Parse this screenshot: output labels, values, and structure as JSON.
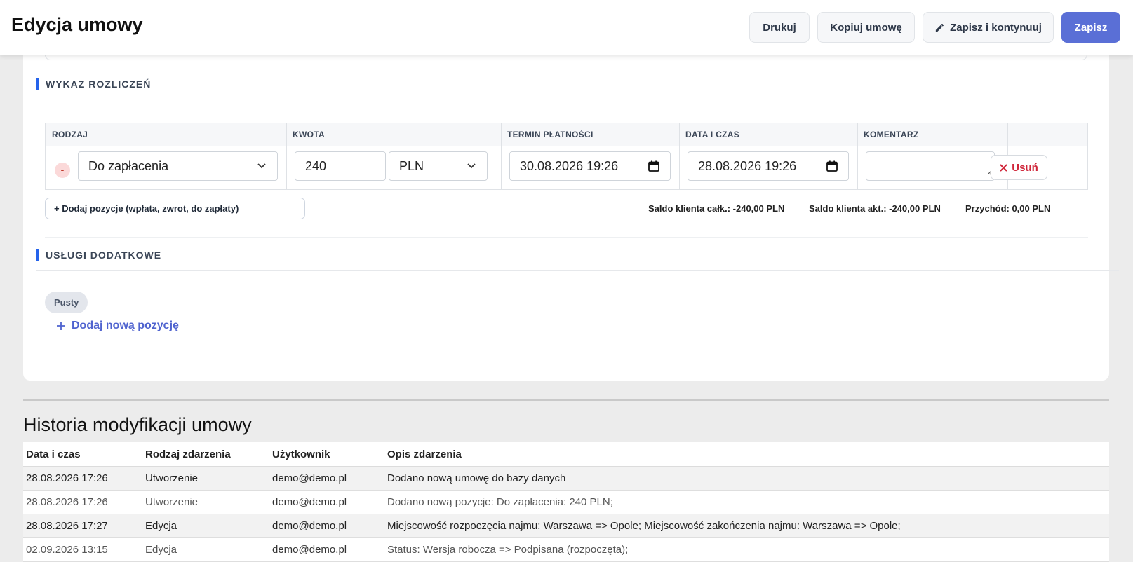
{
  "header": {
    "title": "Edycja umowy",
    "buttons": {
      "print": "Drukuj",
      "copy": "Kopiuj umowę",
      "save_continue": "Zapisz i kontynuuj",
      "save": "Zapisz"
    }
  },
  "settlements": {
    "heading": "WYKAZ ROZLICZEŃ",
    "columns": [
      "RODZAJ",
      "KWOTA",
      "TERMIN PŁATNOŚCI",
      "DATA I CZAS",
      "KOMENTARZ"
    ],
    "row": {
      "remove_marker": "-",
      "type": "Do zapłacenia",
      "amount": "240",
      "currency": "PLN",
      "due_date": "30.08.2026 19:26",
      "datetime": "28.08.2026 19:26",
      "comment": "",
      "delete_label": "Usuń"
    },
    "add_button": "+ Dodaj pozycje (wpłata, zwrot, do zapłaty)",
    "summary": {
      "balance_total": "Saldo klienta całk.: -240,00 PLN",
      "balance_current": "Saldo klienta akt.: -240,00 PLN",
      "income": "Przychód: 0,00 PLN"
    }
  },
  "extra_services": {
    "heading": "USŁUGI DODATKOWE",
    "empty_label": "Pusty",
    "add_label": "Dodaj nową pozycję"
  },
  "history": {
    "title": "Historia modyfikacji umowy",
    "columns": [
      "Data i czas",
      "Rodzaj zdarzenia",
      "Użytkownik",
      "Opis zdarzenia"
    ],
    "rows": [
      [
        "28.08.2026 17:26",
        "Utworzenie",
        "demo@demo.pl",
        "Dodano nową umowę do bazy danych"
      ],
      [
        "28.08.2026 17:26",
        "Utworzenie",
        "demo@demo.pl",
        "Dodano nową pozycje: Do zapłacenia: 240 PLN;"
      ],
      [
        "28.08.2026 17:27",
        "Edycja",
        "demo@demo.pl",
        "Miejscowość rozpoczęcia najmu: Warszawa => Opole; Miejscowość zakończenia najmu: Warszawa => Opole;"
      ],
      [
        "02.09.2026 13:15",
        "Edycja",
        "demo@demo.pl",
        "Status: Wersja robocza => Podpisana (rozpoczęta);"
      ]
    ]
  },
  "colors": {
    "primary": "#5a6fd6",
    "section_accent": "#2563eb",
    "danger": "#d0263a",
    "link": "#4f63cf"
  },
  "icons": [
    "pencil-icon",
    "chevron-down-icon",
    "calendar-icon",
    "close-icon",
    "plus-icon",
    "textarea-resize-icon"
  ]
}
